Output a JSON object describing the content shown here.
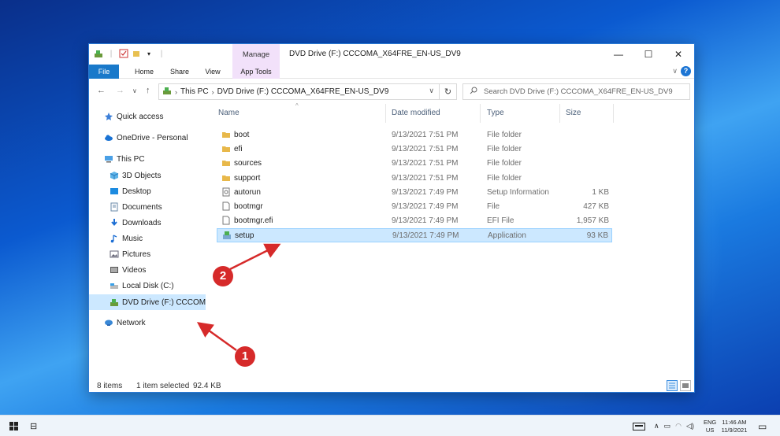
{
  "window": {
    "title": "DVD Drive (F:) CCCOMA_X64FRE_EN-US_DV9",
    "context_tab": "Manage",
    "minimize_glyph": "—",
    "maximize_glyph": "☐",
    "close_glyph": "✕"
  },
  "ribbon": {
    "tabs": [
      "File",
      "Home",
      "Share",
      "View",
      "App Tools"
    ],
    "collapse_glyph": "∨",
    "help_glyph": "?"
  },
  "navbar": {
    "back": "←",
    "forward": "→",
    "recent": "∨",
    "up": "↑",
    "breadcrumb": [
      "This PC",
      "DVD Drive (F:) CCCOMA_X64FRE_EN-US_DV9"
    ],
    "refresh": "↻",
    "search_placeholder": "Search DVD Drive (F:) CCCOMA_X64FRE_EN-US_DV9"
  },
  "nav_pane": {
    "items": [
      {
        "label": "Quick access",
        "icon": "star-icon",
        "level": 0,
        "selected": false
      },
      {
        "label": "OneDrive - Personal",
        "icon": "cloud-icon",
        "level": 0,
        "selected": false
      },
      {
        "label": "This PC",
        "icon": "computer-icon",
        "level": 0,
        "selected": false
      },
      {
        "label": "3D Objects",
        "icon": "cube-icon",
        "level": 1,
        "selected": false
      },
      {
        "label": "Desktop",
        "icon": "desktop-icon",
        "level": 1,
        "selected": false
      },
      {
        "label": "Documents",
        "icon": "document-icon",
        "level": 1,
        "selected": false
      },
      {
        "label": "Downloads",
        "icon": "download-icon",
        "level": 1,
        "selected": false
      },
      {
        "label": "Music",
        "icon": "music-icon",
        "level": 1,
        "selected": false
      },
      {
        "label": "Pictures",
        "icon": "pictures-icon",
        "level": 1,
        "selected": false
      },
      {
        "label": "Videos",
        "icon": "video-icon",
        "level": 1,
        "selected": false
      },
      {
        "label": "Local Disk (C:)",
        "icon": "disk-icon",
        "level": 1,
        "selected": false
      },
      {
        "label": "DVD Drive (F:) CCCOMA",
        "icon": "dvd-icon",
        "level": 1,
        "selected": true
      },
      {
        "label": "Network",
        "icon": "network-icon",
        "level": 0,
        "selected": false
      }
    ]
  },
  "file_list": {
    "columns": [
      "Name",
      "Date modified",
      "Type",
      "Size"
    ],
    "rows": [
      {
        "name": "boot",
        "date": "9/13/2021 7:51 PM",
        "type": "File folder",
        "size": "",
        "icon": "folder-icon",
        "selected": false
      },
      {
        "name": "efi",
        "date": "9/13/2021 7:51 PM",
        "type": "File folder",
        "size": "",
        "icon": "folder-icon",
        "selected": false
      },
      {
        "name": "sources",
        "date": "9/13/2021 7:51 PM",
        "type": "File folder",
        "size": "",
        "icon": "folder-icon",
        "selected": false
      },
      {
        "name": "support",
        "date": "9/13/2021 7:51 PM",
        "type": "File folder",
        "size": "",
        "icon": "folder-icon",
        "selected": false
      },
      {
        "name": "autorun",
        "date": "9/13/2021 7:49 PM",
        "type": "Setup Information",
        "size": "1 KB",
        "icon": "setup-info-icon",
        "selected": false
      },
      {
        "name": "bootmgr",
        "date": "9/13/2021 7:49 PM",
        "type": "File",
        "size": "427 KB",
        "icon": "file-icon",
        "selected": false
      },
      {
        "name": "bootmgr.efi",
        "date": "9/13/2021 7:49 PM",
        "type": "EFI File",
        "size": "1,957 KB",
        "icon": "file-icon",
        "selected": false
      },
      {
        "name": "setup",
        "date": "9/13/2021 7:49 PM",
        "type": "Application",
        "size": "93 KB",
        "icon": "application-icon",
        "selected": true
      }
    ]
  },
  "status": {
    "item_count": "8 items",
    "selection": "1 item selected",
    "size": "92.4 KB"
  },
  "annotations": {
    "badge1": "1",
    "badge2": "2",
    "color": "#d62a2a"
  },
  "taskbar": {
    "language": "ENG",
    "region": "US",
    "time": "11:46 AM",
    "date": "11/9/2021"
  },
  "colors": {
    "accent": "#1979ca",
    "selection": "#cce8ff",
    "context_tab": "#f2e1fa"
  }
}
